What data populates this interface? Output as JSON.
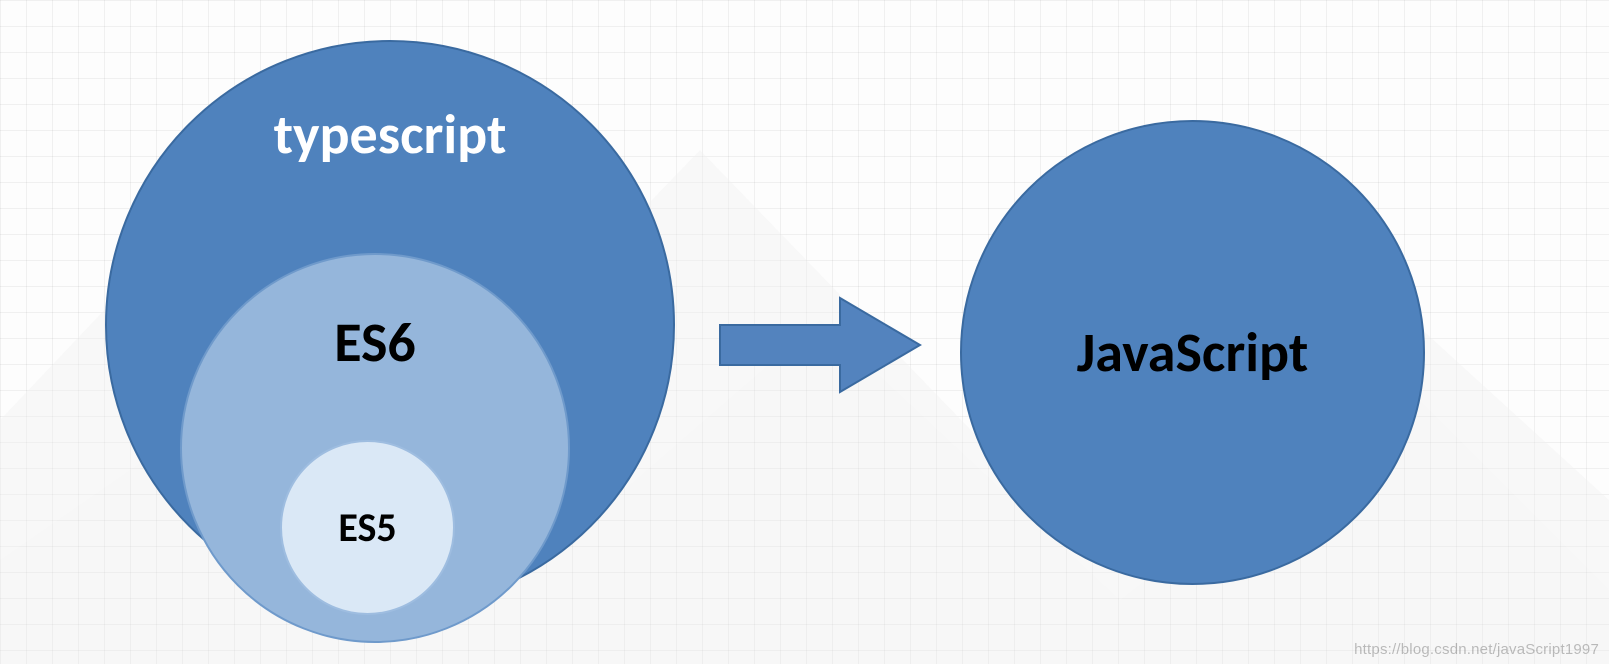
{
  "diagram": {
    "outer_circle_label": "typescript",
    "middle_circle_label": "ES6",
    "inner_circle_label": "ES5",
    "target_circle_label": "JavaScript"
  },
  "colors": {
    "outer_fill": "#4f82bd",
    "middle_fill": "#95b6db",
    "inner_fill": "#dae8f6",
    "target_fill": "#4f82bd",
    "arrow_fill": "#5383be",
    "arrow_stroke": "#3a6aa0"
  },
  "watermark": "https://blog.csdn.net/javaScript1997"
}
